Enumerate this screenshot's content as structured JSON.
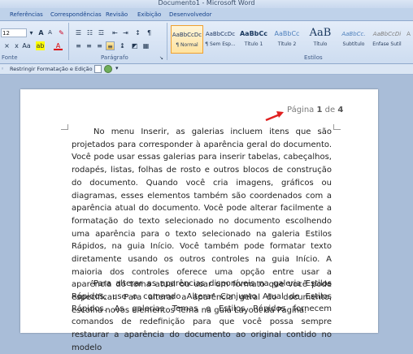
{
  "window": {
    "title": "Documento1 - Microsoft Word"
  },
  "tabs": [
    "Referências",
    "Correspondências",
    "Revisão",
    "Exibição",
    "Desenvolvedor"
  ],
  "font": {
    "size": "12",
    "group_label": "Fonte"
  },
  "paragraph": {
    "group_label": "Parágrafo"
  },
  "styles": {
    "group_label": "Estilos",
    "items": [
      {
        "sample": "AaBbCcDc",
        "name": "¶ Normal",
        "selected": true
      },
      {
        "sample": "AaBbCcDc",
        "name": "¶ Sem Esp..."
      },
      {
        "sample": "AaBbCc",
        "name": "Título 1"
      },
      {
        "sample": "AaBbCc",
        "name": "Título 2"
      },
      {
        "sample": "AaB",
        "name": "Título"
      },
      {
        "sample": "AaBbCc.",
        "name": "Subtítulo"
      },
      {
        "sample": "AaBbCcDi",
        "name": "Ênfase Sutil"
      }
    ]
  },
  "toolbar2": {
    "restrict_label": "Restringir Formatação e Edição"
  },
  "page": {
    "page_label": "Página",
    "page_current": "1",
    "page_of": "de",
    "page_total": "4",
    "paragraph1": "No menu Inserir, as galerias incluem itens que são projetados para corresponder à aparência geral do documento. Você pode usar essas galerias para inserir tabelas, cabeçalhos, rodapés, listas, folhas de rosto e outros blocos de construção do documento. Quando você cria imagens, gráficos ou diagramas, esses elementos também são coordenados com a aparência atual do documento. Você pode alterar facilmente a formatação do texto selecionado no documento escolhendo uma aparência para o texto selecionado na galeria Estilos Rápidos, na guia Início. Você também pode formatar texto diretamente usando os outros controles na guia Início. A maioria dos controles oferece uma opção entre usar a aparência do tema atual ou usar um formato que você pode especificar. Para alterar a aparência geral do documento, escolha novos elementos Tema na guia Layout da Página.",
    "paragraph2": "Para alterar as aparências disponíveis na galeria Estilos Rápidos, use o comando Alterar Conjunto Atual de Estilos Rápidos. As galerias Temas e Estilos Rápidos fornecem comandos de redefinição para que você possa sempre restaurar a aparência do documento ao original contido no modelo"
  },
  "colors": {
    "ribbon": "#dbe6f4",
    "workspace": "#a9bdd8",
    "arrow": "#e02020",
    "accent": "#f0a030"
  }
}
